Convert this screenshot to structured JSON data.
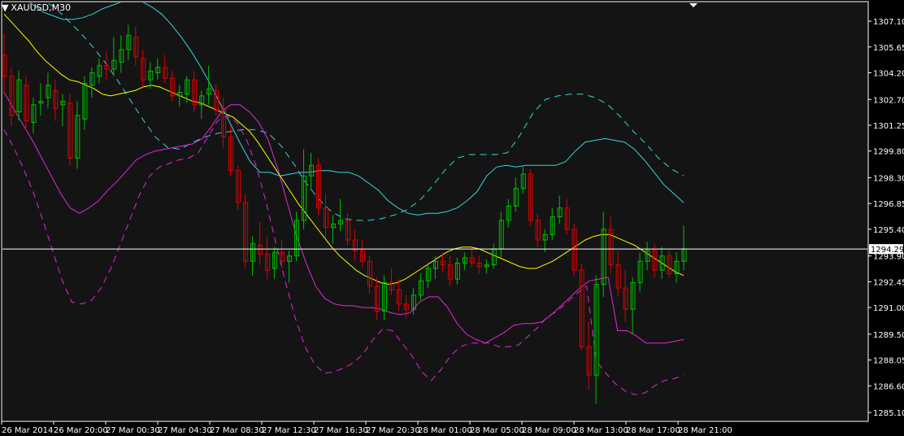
{
  "window": {
    "symbol_label": "XAUUSD,M30",
    "dropdown_icon": "triangle-down-icon"
  },
  "colors": {
    "background": "#141414",
    "frame": "#ffffff",
    "bull": "#00c000",
    "bear": "#e00000",
    "ma": "#ffff00",
    "env_cyan": "#33d6dc",
    "env_magenta": "#e02ad8",
    "price_line": "#ffffff"
  },
  "chart_data": {
    "type": "candlestick",
    "symbol": "XAUUSD",
    "timeframe": "M30",
    "ylim": [
      1284.6,
      1308.2
    ],
    "y_ticks": [
      "1307.10",
      "1305.65",
      "1304.20",
      "1302.70",
      "1301.25",
      "1299.80",
      "1298.30",
      "1296.85",
      "1295.40",
      "1293.90",
      "1292.45",
      "1291.00",
      "1289.50",
      "1288.05",
      "1286.60",
      "1285.10"
    ],
    "current_price": "1294.29",
    "x_ticks": [
      "26 Mar 2014",
      "26 Mar 20:00",
      "27 Mar 00:30",
      "27 Mar 04:30",
      "27 Mar 08:30",
      "27 Mar 12:30",
      "27 Mar 16:30",
      "27 Mar 20:30",
      "28 Mar 01:00",
      "28 Mar 05:00",
      "28 Mar 09:00",
      "28 Mar 13:00",
      "28 Mar 17:00",
      "28 Mar 21:00"
    ],
    "candles": [
      [
        1305.2,
        1306.4,
        1303.0,
        1304.0
      ],
      [
        1304.0,
        1304.5,
        1301.2,
        1301.8
      ],
      [
        1302.0,
        1304.3,
        1301.5,
        1303.8
      ],
      [
        1303.5,
        1304.0,
        1301.0,
        1301.5
      ],
      [
        1301.4,
        1302.8,
        1300.8,
        1302.4
      ],
      [
        1302.5,
        1303.6,
        1301.8,
        1302.6
      ],
      [
        1302.8,
        1304.2,
        1302.2,
        1303.5
      ],
      [
        1303.2,
        1303.8,
        1301.5,
        1302.2
      ],
      [
        1302.4,
        1303.0,
        1301.2,
        1302.6
      ],
      [
        1302.5,
        1303.0,
        1299.0,
        1299.4
      ],
      [
        1299.4,
        1302.6,
        1298.8,
        1301.8
      ],
      [
        1301.6,
        1304.0,
        1301.0,
        1303.6
      ],
      [
        1303.5,
        1304.5,
        1302.8,
        1304.2
      ],
      [
        1304.0,
        1305.0,
        1303.6,
        1304.6
      ],
      [
        1304.6,
        1305.4,
        1303.8,
        1304.4
      ],
      [
        1304.4,
        1306.2,
        1304.0,
        1304.9
      ],
      [
        1304.8,
        1306.3,
        1304.2,
        1305.5
      ],
      [
        1305.5,
        1306.9,
        1304.9,
        1306.3
      ],
      [
        1306.2,
        1306.8,
        1304.6,
        1305.1
      ],
      [
        1305.0,
        1305.5,
        1303.4,
        1303.8
      ],
      [
        1303.8,
        1304.8,
        1303.3,
        1304.3
      ],
      [
        1304.2,
        1305.0,
        1303.8,
        1304.5
      ],
      [
        1304.5,
        1305.2,
        1303.6,
        1303.9
      ],
      [
        1303.9,
        1304.3,
        1302.6,
        1302.9
      ],
      [
        1302.9,
        1303.5,
        1302.3,
        1303.1
      ],
      [
        1303.0,
        1304.0,
        1302.5,
        1303.8
      ],
      [
        1303.8,
        1304.3,
        1302.0,
        1302.4
      ],
      [
        1302.4,
        1303.2,
        1301.6,
        1302.9
      ],
      [
        1303.0,
        1304.6,
        1302.4,
        1303.3
      ],
      [
        1303.2,
        1303.6,
        1301.8,
        1302.1
      ],
      [
        1302.2,
        1302.8,
        1300.0,
        1300.6
      ],
      [
        1300.6,
        1301.2,
        1298.4,
        1298.7
      ],
      [
        1298.7,
        1299.0,
        1296.5,
        1296.9
      ],
      [
        1296.9,
        1297.4,
        1293.2,
        1293.6
      ],
      [
        1293.6,
        1295.0,
        1292.8,
        1294.6
      ],
      [
        1294.5,
        1295.8,
        1293.4,
        1294.0
      ],
      [
        1294.0,
        1295.0,
        1292.6,
        1293.1
      ],
      [
        1293.2,
        1294.4,
        1292.6,
        1294.1
      ],
      [
        1294.1,
        1294.8,
        1293.2,
        1293.6
      ],
      [
        1293.6,
        1294.2,
        1292.4,
        1293.9
      ],
      [
        1293.9,
        1296.4,
        1293.6,
        1295.9
      ],
      [
        1295.9,
        1299.9,
        1295.4,
        1298.4
      ],
      [
        1298.4,
        1299.7,
        1297.6,
        1299.0
      ],
      [
        1299.0,
        1299.4,
        1296.2,
        1296.6
      ],
      [
        1296.6,
        1297.4,
        1295.0,
        1295.5
      ],
      [
        1295.5,
        1296.2,
        1294.6,
        1295.7
      ],
      [
        1295.7,
        1297.1,
        1295.3,
        1295.9
      ],
      [
        1295.9,
        1296.3,
        1294.5,
        1294.8
      ],
      [
        1294.8,
        1295.4,
        1293.6,
        1294.2
      ],
      [
        1294.2,
        1294.8,
        1293.3,
        1293.6
      ],
      [
        1293.6,
        1293.9,
        1291.8,
        1292.2
      ],
      [
        1292.2,
        1292.7,
        1290.3,
        1290.8
      ],
      [
        1290.8,
        1292.8,
        1290.3,
        1292.4
      ],
      [
        1292.4,
        1293.2,
        1291.7,
        1292.0
      ],
      [
        1292.0,
        1292.6,
        1290.8,
        1291.2
      ],
      [
        1291.2,
        1291.7,
        1290.4,
        1290.9
      ],
      [
        1290.9,
        1292.1,
        1290.6,
        1291.7
      ],
      [
        1291.7,
        1292.9,
        1291.4,
        1292.5
      ],
      [
        1292.5,
        1293.5,
        1292.1,
        1293.2
      ],
      [
        1293.2,
        1293.9,
        1292.6,
        1293.6
      ],
      [
        1293.6,
        1294.1,
        1293.0,
        1293.4
      ],
      [
        1293.4,
        1293.9,
        1292.2,
        1292.6
      ],
      [
        1292.6,
        1293.8,
        1292.3,
        1293.5
      ],
      [
        1293.5,
        1294.1,
        1293.1,
        1293.8
      ],
      [
        1293.8,
        1294.3,
        1293.3,
        1293.5
      ],
      [
        1293.5,
        1293.9,
        1292.9,
        1293.3
      ],
      [
        1293.3,
        1293.7,
        1292.9,
        1293.4
      ],
      [
        1293.4,
        1294.6,
        1293.2,
        1294.3
      ],
      [
        1294.3,
        1296.4,
        1293.8,
        1295.9
      ],
      [
        1295.9,
        1297.1,
        1295.5,
        1296.7
      ],
      [
        1296.7,
        1298.3,
        1296.4,
        1297.7
      ],
      [
        1297.7,
        1298.9,
        1297.4,
        1298.5
      ],
      [
        1298.5,
        1298.8,
        1295.6,
        1295.9
      ],
      [
        1295.9,
        1296.3,
        1294.4,
        1294.8
      ],
      [
        1294.8,
        1295.4,
        1294.1,
        1295.1
      ],
      [
        1295.1,
        1296.6,
        1294.8,
        1296.1
      ],
      [
        1296.1,
        1297.3,
        1295.7,
        1296.6
      ],
      [
        1296.6,
        1297.1,
        1295.1,
        1295.4
      ],
      [
        1295.4,
        1295.7,
        1292.8,
        1293.1
      ],
      [
        1293.1,
        1293.5,
        1288.6,
        1288.8
      ],
      [
        1288.8,
        1290.2,
        1286.4,
        1287.2
      ],
      [
        1287.2,
        1292.8,
        1285.6,
        1292.3
      ],
      [
        1292.3,
        1296.4,
        1291.6,
        1295.4
      ],
      [
        1295.4,
        1296.1,
        1292.9,
        1293.4
      ],
      [
        1293.4,
        1294.2,
        1291.6,
        1292.1
      ],
      [
        1292.1,
        1293.1,
        1290.2,
        1290.9
      ],
      [
        1290.9,
        1292.7,
        1289.5,
        1292.4
      ],
      [
        1292.4,
        1294.1,
        1291.9,
        1293.6
      ],
      [
        1293.6,
        1294.7,
        1293.1,
        1294.2
      ],
      [
        1294.2,
        1294.6,
        1292.7,
        1293.1
      ],
      [
        1293.1,
        1294.4,
        1292.6,
        1293.9
      ],
      [
        1293.9,
        1294.2,
        1292.7,
        1292.9
      ],
      [
        1292.9,
        1294.1,
        1292.4,
        1293.6
      ],
      [
        1293.6,
        1295.6,
        1293.1,
        1294.3
      ]
    ],
    "ma": [
      1307.5,
      1307.0,
      1306.5,
      1306.0,
      1305.4,
      1304.9,
      1304.5,
      1304.1,
      1303.8,
      1303.7,
      1303.5,
      1303.3,
      1303.0,
      1302.9,
      1303.0,
      1303.1,
      1303.2,
      1303.4,
      1303.5,
      1303.4,
      1303.2,
      1303.0,
      1302.8,
      1302.6,
      1302.5,
      1302.3,
      1302.1,
      1301.9,
      1301.7,
      1301.3,
      1300.9,
      1300.3,
      1299.6,
      1298.9,
      1298.2,
      1297.5,
      1296.8,
      1296.2,
      1295.6,
      1295.0,
      1294.4,
      1293.9,
      1293.5,
      1293.1,
      1292.8,
      1292.6,
      1292.4,
      1292.3,
      1292.4,
      1292.6,
      1292.9,
      1293.2,
      1293.5,
      1293.8,
      1294.1,
      1294.3,
      1294.4,
      1294.4,
      1294.3,
      1294.1,
      1293.9,
      1293.7,
      1293.5,
      1293.3,
      1293.2,
      1293.2,
      1293.4,
      1293.6,
      1293.9,
      1294.2,
      1294.5,
      1294.8,
      1295.0,
      1295.1,
      1295.1,
      1294.9,
      1294.7,
      1294.5,
      1294.2,
      1293.9,
      1293.6,
      1293.3,
      1293.0,
      1292.8
    ],
    "env_cyan_solid": [
      1308.4,
      1308.4,
      1308.4,
      1308.0,
      1307.6,
      1307.4,
      1307.2,
      1307.2,
      1307.3,
      1307.5,
      1307.8,
      1308.0,
      1308.2,
      1308.3,
      1308.2,
      1307.9,
      1307.5,
      1306.9,
      1306.2,
      1305.4,
      1304.5,
      1303.5,
      1302.4,
      1301.3,
      1300.2,
      1299.2,
      1298.6,
      1298.6,
      1298.4,
      1298.5,
      1298.6,
      1298.6,
      1298.7,
      1298.7,
      1298.6,
      1298.6,
      1298.4,
      1298.0,
      1297.6,
      1297.0,
      1296.6,
      1296.3,
      1296.2,
      1296.3,
      1296.3,
      1296.4,
      1296.6,
      1297.0,
      1297.5,
      1298.4,
      1298.9,
      1299.0,
      1298.9,
      1299.0,
      1299.0,
      1299.0,
      1299.0,
      1299.2,
      1299.8,
      1300.3,
      1300.4,
      1300.5,
      1300.4,
      1300.3,
      1299.9,
      1299.3,
      1298.6,
      1297.9,
      1297.4,
      1296.9
    ],
    "env_cyan_dashed": [
      1308.4,
      1308.4,
      1308.4,
      1308.3,
      1307.9,
      1307.2,
      1306.5,
      1305.7,
      1304.8,
      1303.8,
      1302.7,
      1301.6,
      1300.6,
      1300.0,
      1299.9,
      1300.3,
      1300.6,
      1300.8,
      1300.9,
      1301.0,
      1301.0,
      1300.8,
      1300.1,
      1299.1,
      1298.0,
      1297.1,
      1296.4,
      1296.0,
      1295.9,
      1295.9,
      1296.0,
      1296.2,
      1296.5,
      1297.0,
      1297.8,
      1298.7,
      1299.4,
      1299.6,
      1299.6,
      1299.6,
      1299.7,
      1300.7,
      1301.9,
      1302.7,
      1302.9,
      1303.0,
      1303.0,
      1302.8,
      1302.4,
      1301.7,
      1300.9,
      1300.2,
      1299.4,
      1298.8,
      1298.4
    ],
    "env_magenta_solid": [
      1303.1,
      1302.2,
      1301.3,
      1300.4,
      1299.4,
      1298.4,
      1297.4,
      1296.6,
      1296.3,
      1296.6,
      1297.0,
      1297.6,
      1298.1,
      1298.7,
      1299.3,
      1299.6,
      1299.8,
      1299.9,
      1300.0,
      1300.1,
      1300.2,
      1300.5,
      1301.2,
      1302.0,
      1302.4,
      1302.4,
      1302.0,
      1301.4,
      1300.4,
      1298.8,
      1296.9,
      1295.0,
      1293.5,
      1292.2,
      1291.5,
      1291.2,
      1291.1,
      1291.1,
      1291.0,
      1291.0,
      1290.9,
      1290.7,
      1290.6,
      1290.7,
      1291.3,
      1291.6,
      1291.6,
      1291.0,
      1290.1,
      1289.5,
      1289.2,
      1289.0,
      1289.3,
      1289.6,
      1290.0,
      1290.1,
      1290.1,
      1290.2,
      1290.6,
      1291.1,
      1291.6,
      1292.1,
      1292.5,
      1292.6,
      1292.7,
      1289.7,
      1289.7,
      1289.4,
      1289.0,
      1289.0,
      1289.0,
      1289.1,
      1289.2
    ],
    "env_magenta_dashed": [
      1301.0,
      1300.0,
      1298.8,
      1297.5,
      1295.9,
      1294.2,
      1292.5,
      1291.3,
      1291.2,
      1291.4,
      1292.1,
      1293.2,
      1294.6,
      1296.0,
      1297.4,
      1298.4,
      1298.9,
      1299.1,
      1299.3,
      1299.4,
      1299.7,
      1300.6,
      1301.5,
      1301.8,
      1301.4,
      1300.4,
      1298.9,
      1296.9,
      1294.6,
      1292.4,
      1290.4,
      1288.8,
      1287.8,
      1287.3,
      1287.4,
      1287.6,
      1287.9,
      1288.4,
      1289.2,
      1289.8,
      1289.7,
      1289.0,
      1288.3,
      1287.4,
      1286.9,
      1287.5,
      1288.3,
      1288.8,
      1289.0,
      1289.0,
      1289.0,
      1288.8,
      1288.8,
      1288.9,
      1289.4,
      1289.9,
      1290.5,
      1290.8,
      1291.3,
      1291.8,
      1292.2,
      1288.0,
      1287.3,
      1286.7,
      1286.3,
      1286.1,
      1286.2,
      1286.6,
      1286.9,
      1287.0,
      1287.2
    ]
  }
}
